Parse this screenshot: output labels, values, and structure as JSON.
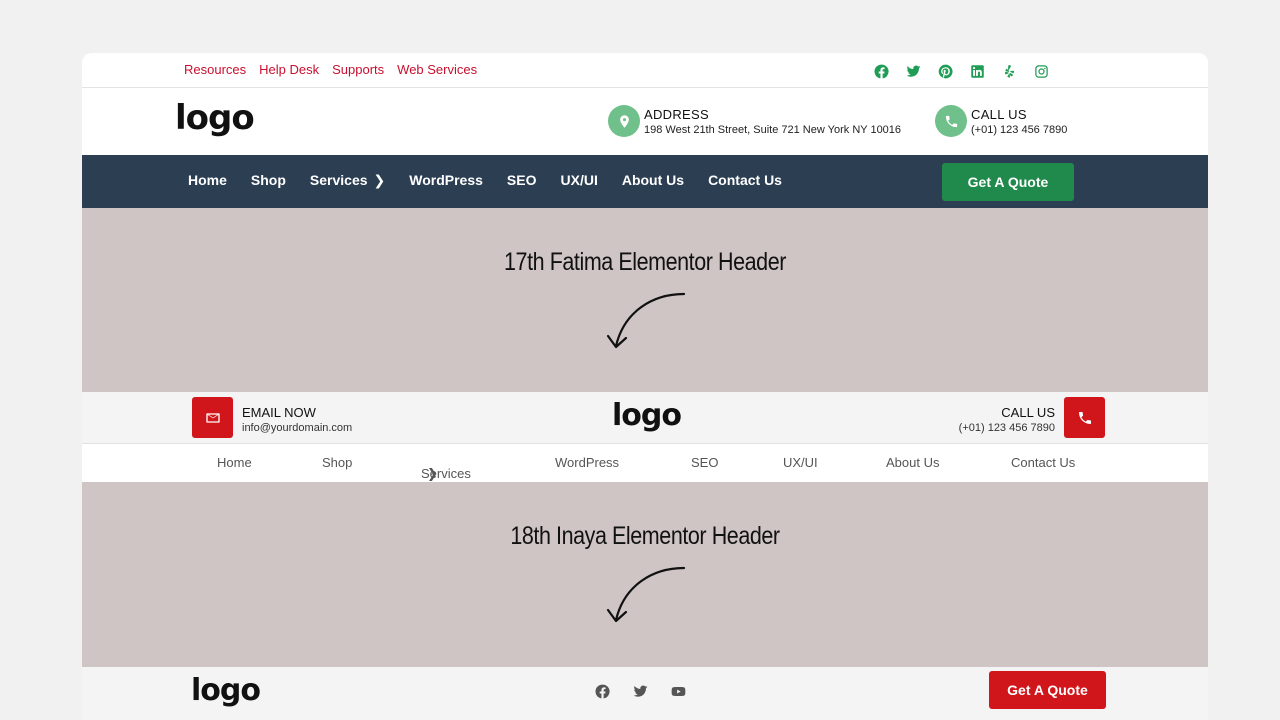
{
  "header17": {
    "top_links": [
      "Resources",
      "Help Desk",
      "Supports",
      "Web Services"
    ],
    "social_icons": [
      "facebook-icon",
      "twitter-icon",
      "pinterest-icon",
      "linkedin-icon",
      "yelp-icon",
      "instagram-icon"
    ],
    "logo": "logo",
    "address": {
      "label": "ADDRESS",
      "value": "198 West 21th Street, Suite 721 New York NY 10016"
    },
    "call": {
      "label": "CALL US",
      "value": "(+01) 123 456 7890"
    },
    "nav": [
      "Home",
      "Shop",
      "Services",
      "WordPress",
      "SEO",
      "UX/UI",
      "About Us",
      "Contact Us"
    ],
    "quote_button": "Get A Quote",
    "colors": {
      "nav_bg": "#2c3e52",
      "accent": "#1f8a4c",
      "link": "#c8102e"
    }
  },
  "banner1": {
    "title": "17th Fatima Elementor Header"
  },
  "header18": {
    "email": {
      "label": "EMAIL NOW",
      "value": "info@yourdomain.com"
    },
    "logo": "logo",
    "call": {
      "label": "CALL US",
      "value": "(+01) 123 456 7890"
    },
    "nav": [
      "Home",
      "Shop",
      "Services",
      "WordPress",
      "SEO",
      "UX/UI",
      "About Us",
      "Contact Us"
    ],
    "colors": {
      "accent": "#d0161b"
    }
  },
  "banner2": {
    "title": "18th Inaya Elementor Header"
  },
  "header19": {
    "logo": "logo",
    "social_icons": [
      "facebook-icon",
      "twitter-icon",
      "youtube-icon"
    ],
    "quote_button": "Get A Quote"
  }
}
